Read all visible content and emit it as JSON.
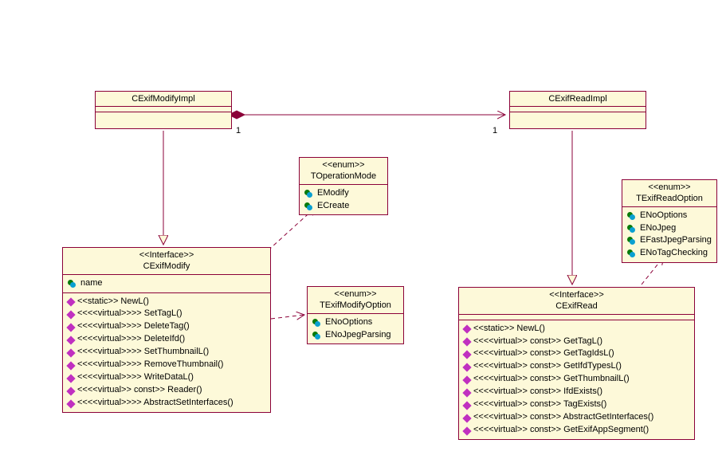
{
  "diagram_type": "UML Class Diagram",
  "boxes": {
    "modifyImpl": {
      "name": "CExifModifyImpl"
    },
    "readImpl": {
      "name": "CExifReadImpl"
    },
    "opMode": {
      "stereotype": "<<enum>>",
      "name": "TOperationMode",
      "literals": [
        "EModify",
        "ECreate"
      ]
    },
    "modifyOpt": {
      "stereotype": "<<enum>>",
      "name": "TExifModifyOption",
      "literals": [
        "ENoOptions",
        "ENoJpegParsing"
      ]
    },
    "readOpt": {
      "stereotype": "<<enum>>",
      "name": "TExifReadOption",
      "literals": [
        "ENoOptions",
        "ENoJpeg",
        "EFastJpegParsing",
        "ENoTagChecking"
      ]
    },
    "modify": {
      "stereotype": "<<Interface>>",
      "name": "CExifModify",
      "attrs": [
        "name"
      ],
      "ops": [
        "<<static>> NewL()",
        "<<<<virtual>>>> SetTagL()",
        "<<<<virtual>>>> DeleteTag()",
        "<<<<virtual>>>> DeleteIfd()",
        "<<<<virtual>>>> SetThumbnailL()",
        "<<<<virtual>>>> RemoveThumbnail()",
        "<<<<virtual>>>> WriteDataL()",
        "<<<<virtual>> const>> Reader()",
        "<<<<virtual>>>> AbstractSetInterfaces()"
      ]
    },
    "read": {
      "stereotype": "<<Interface>>",
      "name": "CExifRead",
      "ops": [
        "<<static>> NewL()",
        "<<<<virtual>> const>> GetTagL()",
        "<<<<virtual>> const>> GetTagIdsL()",
        "<<<<virtual>> const>> GetIfdTypesL()",
        "<<<<virtual>> const>> GetThumbnailL()",
        "<<<<virtual>> const>> IfdExists()",
        "<<<<virtual>> const>> TagExists()",
        "<<<<virtual>> const>> AbstractGetInterfaces()",
        "<<<<virtual>> const>> GetExifAppSegment()"
      ]
    }
  },
  "multiplicities": {
    "compLeft": "1",
    "compRight": "1"
  }
}
